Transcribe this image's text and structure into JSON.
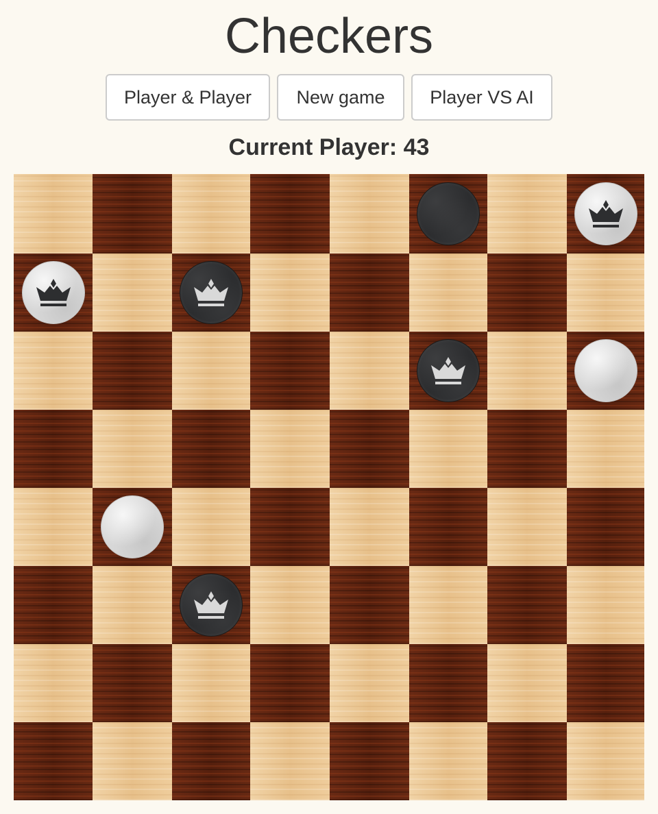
{
  "title": "Checkers",
  "buttons": {
    "player_vs_player": "Player & Player",
    "new_game": "New game",
    "player_vs_ai": "Player VS AI"
  },
  "status": {
    "text": "Current Player: 43"
  },
  "board": {
    "size": 8,
    "light_square_color": "#ecc996",
    "dark_square_color": "#5e2410",
    "pieces": [
      {
        "row": 0,
        "col": 5,
        "color": "black",
        "king": false
      },
      {
        "row": 0,
        "col": 7,
        "color": "white",
        "king": true
      },
      {
        "row": 1,
        "col": 0,
        "color": "white",
        "king": true
      },
      {
        "row": 1,
        "col": 2,
        "color": "black",
        "king": true
      },
      {
        "row": 2,
        "col": 5,
        "color": "black",
        "king": true
      },
      {
        "row": 2,
        "col": 7,
        "color": "white",
        "king": false
      },
      {
        "row": 4,
        "col": 1,
        "color": "white",
        "king": false
      },
      {
        "row": 5,
        "col": 2,
        "color": "black",
        "king": true
      }
    ]
  },
  "icons": {
    "king": "crown-icon"
  }
}
